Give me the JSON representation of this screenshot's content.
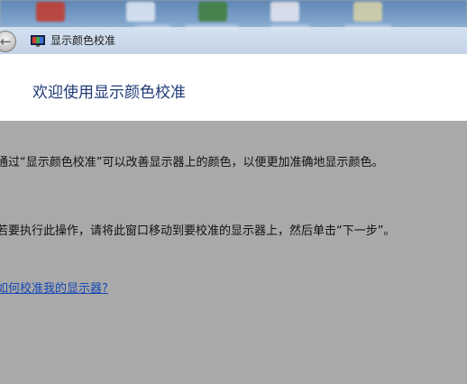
{
  "window": {
    "title": "显示颜色校准"
  },
  "header": {
    "heading": "欢迎使用显示颜色校准"
  },
  "content": {
    "paragraph_1": "通过“显示颜色校准”可以改善显示器上的颜色，以便更加准确地显示颜色。",
    "paragraph_2": "若要执行此操作，请将此窗口移动到要校准的显示器上，然后单击“下一步”。",
    "help_link": "如何校准我的显示器?"
  },
  "colors": {
    "heading": "#1f3a78",
    "link": "#1646b4",
    "content_background": "#a9a9a9",
    "header_background": "#ffffff"
  },
  "icons": {
    "back": "back-arrow-icon",
    "app": "display-color-calibration-icon"
  }
}
